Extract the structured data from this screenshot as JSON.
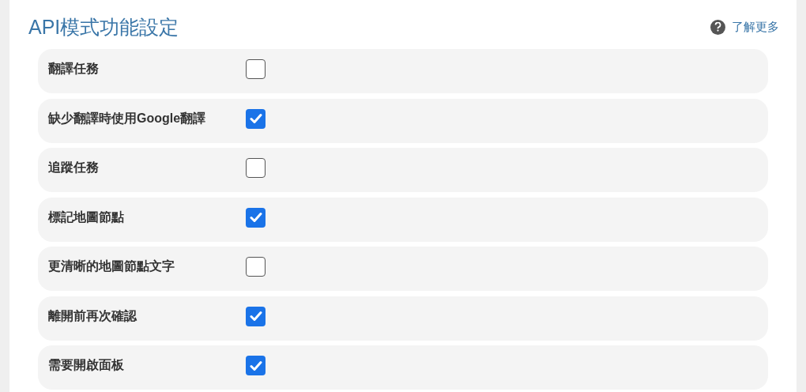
{
  "title": "API模式功能設定",
  "help_link": {
    "label": "了解更多"
  },
  "settings": [
    {
      "label": "翻譯任務",
      "checked": false
    },
    {
      "label": "缺少翻譯時使用Google翻譯",
      "checked": true
    },
    {
      "label": "追蹤任務",
      "checked": false
    },
    {
      "label": "標記地圖節點",
      "checked": true
    },
    {
      "label": "更清晰的地圖節點文字",
      "checked": false
    },
    {
      "label": "離開前再次確認",
      "checked": true
    },
    {
      "label": "需要開啟面板",
      "checked": true
    }
  ]
}
